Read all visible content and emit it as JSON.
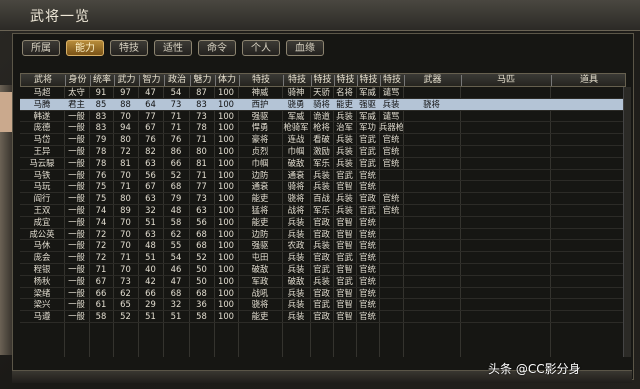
{
  "window": {
    "title": "武将一览"
  },
  "tabs": [
    "所属",
    "能力",
    "特技",
    "适性",
    "命令",
    "个人",
    "血缘"
  ],
  "active_tab": "能力",
  "columns": [
    "武将",
    "身份",
    "统率",
    "武力",
    "智力",
    "政治",
    "魅力",
    "体力",
    "特技",
    "特技",
    "特技",
    "特技",
    "特技",
    "特技",
    "武器",
    "马匹",
    "道具"
  ],
  "selected_row": 1,
  "rows": [
    [
      "马超",
      "太守",
      "91",
      "97",
      "47",
      "54",
      "87",
      "100",
      "神威",
      "骑神",
      "天骄",
      "名将",
      "军威",
      "谴骂",
      "",
      "",
      ""
    ],
    [
      "马腾",
      "君主",
      "85",
      "88",
      "64",
      "73",
      "83",
      "100",
      "西护",
      "骁勇",
      "骑将",
      "能吏",
      "强驱",
      "兵装",
      "骁将",
      "",
      ""
    ],
    [
      "韩遂",
      "一般",
      "83",
      "70",
      "77",
      "71",
      "73",
      "100",
      "强驱",
      "军威",
      "诡道",
      "兵装",
      "军威",
      "谴骂",
      "",
      "",
      ""
    ],
    [
      "庞德",
      "一般",
      "83",
      "94",
      "67",
      "71",
      "78",
      "100",
      "悍勇",
      "枪骑军",
      "枪将",
      "治军",
      "军功",
      "兵器枪",
      "",
      "",
      ""
    ],
    [
      "马岱",
      "一般",
      "79",
      "80",
      "76",
      "76",
      "71",
      "100",
      "豪将",
      "连战",
      "看破",
      "兵装",
      "官武",
      "官统",
      "",
      "",
      ""
    ],
    [
      "王异",
      "一般",
      "78",
      "72",
      "82",
      "86",
      "80",
      "100",
      "贞烈",
      "巾帼",
      "激励",
      "兵装",
      "官武",
      "官统",
      "",
      "",
      ""
    ],
    [
      "马云騄",
      "一般",
      "78",
      "81",
      "63",
      "66",
      "81",
      "100",
      "巾帼",
      "破敌",
      "军乐",
      "兵装",
      "官武",
      "官统",
      "",
      "",
      ""
    ],
    [
      "马铁",
      "一般",
      "76",
      "70",
      "56",
      "52",
      "71",
      "100",
      "边防",
      "通衰",
      "兵装",
      "官武",
      "官统",
      "",
      "",
      "",
      ""
    ],
    [
      "马玩",
      "一般",
      "75",
      "71",
      "67",
      "68",
      "77",
      "100",
      "通衰",
      "骑将",
      "兵装",
      "官智",
      "官统",
      "",
      "",
      "",
      ""
    ],
    [
      "阎行",
      "一般",
      "75",
      "80",
      "63",
      "79",
      "73",
      "100",
      "能吏",
      "骁将",
      "百战",
      "兵装",
      "官政",
      "官统",
      "",
      "",
      ""
    ],
    [
      "王双",
      "一般",
      "74",
      "89",
      "32",
      "48",
      "63",
      "100",
      "猛将",
      "战将",
      "军乐",
      "兵装",
      "官武",
      "官统",
      "",
      "",
      ""
    ],
    [
      "成宜",
      "一般",
      "74",
      "70",
      "51",
      "58",
      "56",
      "100",
      "能吏",
      "兵装",
      "官政",
      "官智",
      "官统",
      "",
      "",
      "",
      ""
    ],
    [
      "成公英",
      "一般",
      "72",
      "70",
      "63",
      "62",
      "68",
      "100",
      "边防",
      "兵装",
      "官政",
      "官智",
      "官统",
      "",
      "",
      "",
      ""
    ],
    [
      "马休",
      "一般",
      "72",
      "70",
      "48",
      "55",
      "68",
      "100",
      "强驱",
      "农政",
      "兵装",
      "官智",
      "官统",
      "",
      "",
      "",
      ""
    ],
    [
      "庞会",
      "一般",
      "72",
      "71",
      "51",
      "54",
      "52",
      "100",
      "屯田",
      "兵装",
      "官政",
      "官武",
      "官统",
      "",
      "",
      "",
      ""
    ],
    [
      "程银",
      "一般",
      "71",
      "70",
      "40",
      "46",
      "50",
      "100",
      "破敌",
      "兵装",
      "官武",
      "官智",
      "官统",
      "",
      "",
      "",
      ""
    ],
    [
      "杨秋",
      "一般",
      "67",
      "73",
      "42",
      "47",
      "50",
      "100",
      "军政",
      "破敌",
      "兵装",
      "官武",
      "官统",
      "",
      "",
      "",
      ""
    ],
    [
      "梁绪",
      "一般",
      "66",
      "62",
      "66",
      "68",
      "68",
      "100",
      "战吼",
      "兵装",
      "官政",
      "官智",
      "官统",
      "",
      "",
      "",
      ""
    ],
    [
      "梁兴",
      "一般",
      "61",
      "65",
      "29",
      "32",
      "36",
      "100",
      "骁将",
      "兵装",
      "官武",
      "官智",
      "官统",
      "",
      "",
      "",
      ""
    ],
    [
      "马遵",
      "一般",
      "58",
      "52",
      "51",
      "51",
      "58",
      "100",
      "能吏",
      "兵装",
      "官政",
      "官智",
      "官统",
      "",
      "",
      "",
      ""
    ]
  ],
  "watermark": "头条 @CC影分身"
}
